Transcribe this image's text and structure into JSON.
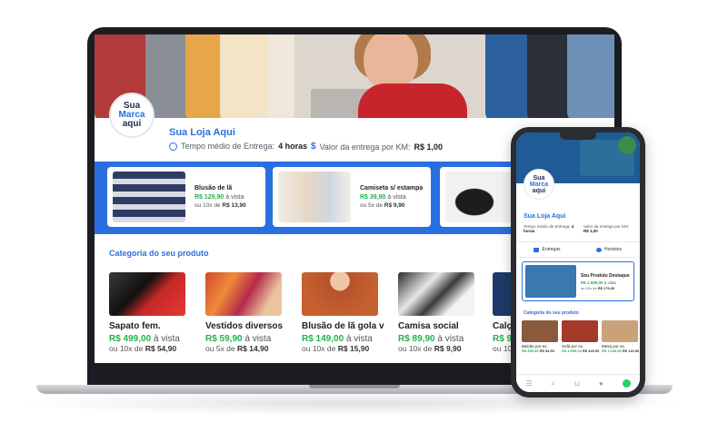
{
  "store": {
    "logo_line1": "Sua",
    "logo_line2": "Marca",
    "logo_line3": "aqui",
    "name": "Sua Loja Aqui",
    "delivery_time_label": "Tempo médio de Entrega:",
    "delivery_time_value": "4 horas",
    "delivery_fee_label": "Valor da entrega por KM:",
    "delivery_fee_value": "R$ 1,00"
  },
  "featured": [
    {
      "name": "Blusão de lã",
      "price": "R$ 129,90",
      "price_suffix": "à vista",
      "inst_prefix": "ou 10x de",
      "inst_value": "R$ 13,90"
    },
    {
      "name": "Camiseta s/ estampa",
      "price": "R$ 39,90",
      "price_suffix": "à vista",
      "inst_prefix": "ou 5x de",
      "inst_value": "R$ 9,90"
    }
  ],
  "category": {
    "title": "Categoria do seu produto",
    "products": [
      {
        "name": "Sapato fem.",
        "price": "R$ 499,00",
        "price_suffix": "à vista",
        "inst_prefix": "ou 10x de",
        "inst_value": "R$ 54,90"
      },
      {
        "name": "Vestidos diversos",
        "price": "R$ 59,90",
        "price_suffix": "à vista",
        "inst_prefix": "ou 5x de",
        "inst_value": "R$ 14,90"
      },
      {
        "name": "Blusão de lã gola v",
        "price": "R$ 149,00",
        "price_suffix": "à vista",
        "inst_prefix": "ou 10x de",
        "inst_value": "R$ 15,90"
      },
      {
        "name": "Camisa social",
        "price": "R$ 89,90",
        "price_suffix": "à vista",
        "inst_prefix": "ou 10x de",
        "inst_value": "R$ 9,90"
      },
      {
        "name": "Calça",
        "price": "R$ 99",
        "price_suffix": "",
        "inst_prefix": "ou 10x",
        "inst_value": ""
      }
    ]
  },
  "phone": {
    "logo_line1": "Sua",
    "logo_line2": "Marca",
    "logo_line3": "aqui",
    "store_name": "Sua Loja Aqui",
    "meta1_label": "Tempo médio de Entrega:",
    "meta1_value": "4 horas",
    "meta2_label": "Valor da entrega por KM:",
    "meta2_value": "R$ 1,00",
    "tab1": "Entregas",
    "tab2": "Horários",
    "featured": {
      "name": "Seu Produto Destaque",
      "price": "R$ 1.599,00",
      "price_suffix": "à vista",
      "inst_prefix": "ou 10x de",
      "inst_value": "R$ 179,90"
    },
    "category_title": "Categoria do seu produto",
    "products": [
      {
        "name": "Balcão por ex.",
        "price": "R$ 499,00",
        "inst": "R$ 54,90"
      },
      {
        "name": "Sofá por ex.",
        "price": "R$ 3.999,00",
        "inst": "R$ 449,90"
      },
      {
        "name": "Mesa por ex.",
        "price": "R$ 1.049,00",
        "inst": "R$ 115,90"
      }
    ]
  },
  "colors": {
    "accent": "#2a6fe0",
    "price_green": "#21b34a"
  }
}
